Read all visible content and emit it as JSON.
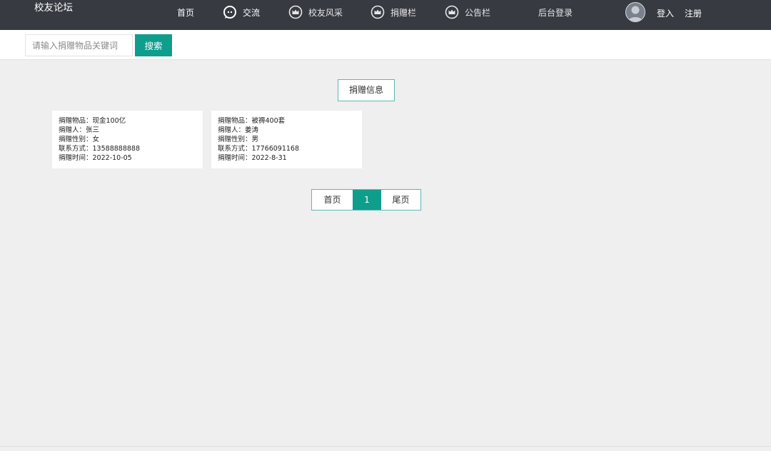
{
  "header": {
    "brand": "校友论坛",
    "nav": [
      {
        "label": "首页",
        "icon": ""
      },
      {
        "label": "交流",
        "icon": "chat-bubble-icon"
      },
      {
        "label": "校友风采",
        "icon": "crown-icon"
      },
      {
        "label": "捐赠栏",
        "icon": "crown-icon"
      },
      {
        "label": "公告栏",
        "icon": "crown-icon"
      },
      {
        "label": "后台登录",
        "icon": ""
      }
    ],
    "login": "登入",
    "register": "注册",
    "avatar_icon": "user-avatar-icon"
  },
  "search": {
    "placeholder": "请输入捐赠物品关键词",
    "value": "",
    "button": "搜索"
  },
  "section_title": "捐赠信息",
  "donations": [
    {
      "item_label": "捐赠物品：",
      "item": "现金100亿",
      "donor_label": "捐赠人：",
      "donor": "张三",
      "gender_label": "捐赠性别：",
      "gender": "女",
      "contact_label": "联系方式：",
      "contact": "13588888888",
      "time_label": "捐赠时间：",
      "time": "2022-10-05"
    },
    {
      "item_label": "捐赠物品：",
      "item": "被褥400套",
      "donor_label": "捐赠人：",
      "donor": "姜涛",
      "gender_label": "捐赠性别：",
      "gender": "男",
      "contact_label": "联系方式：",
      "contact": "17766091168",
      "time_label": "捐赠时间：",
      "time": "2022-8-31"
    }
  ],
  "pagination": {
    "first": "首页",
    "current": "1",
    "last": "尾页"
  },
  "colors": {
    "topbar": "#383a42",
    "accent": "#0f9d8c",
    "page_bg": "#efefef"
  }
}
